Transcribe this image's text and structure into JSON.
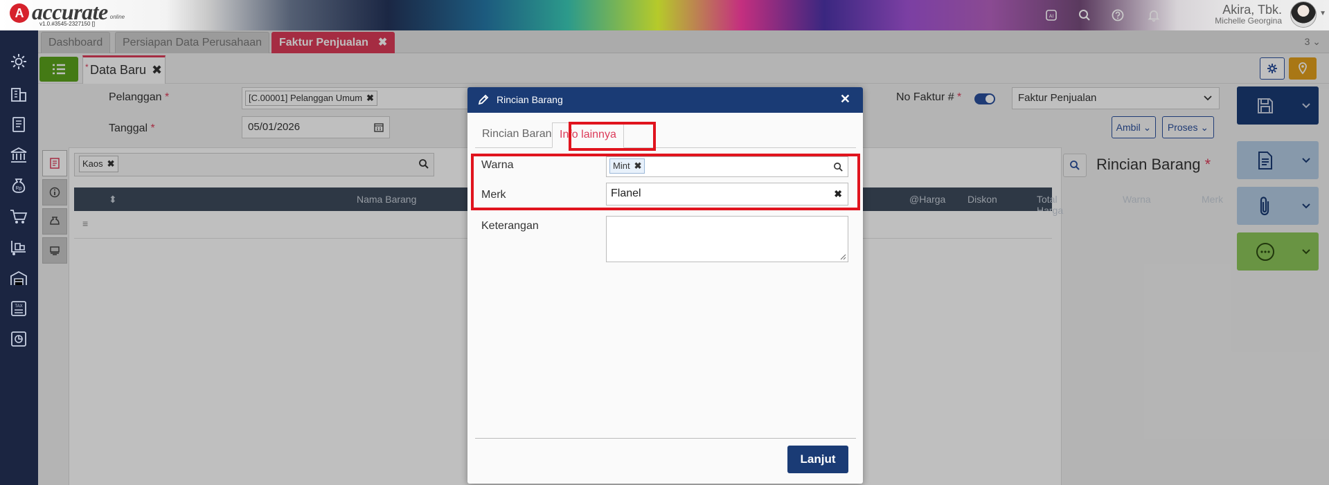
{
  "app": {
    "logo_letter": "A",
    "logo_name": "accurate",
    "logo_suffix": "online",
    "version": "v1.0.#3545-2327150 []",
    "company": "Akira, Tbk.",
    "user": "Michelle Georgina"
  },
  "tabs": {
    "items": [
      {
        "label": "Dashboard"
      },
      {
        "label": "Persiapan Data Perusahaan"
      },
      {
        "label": "Faktur Penjualan",
        "close": "✖"
      }
    ],
    "count": "3 ⌄"
  },
  "document_tab": {
    "star": "*",
    "label": "Data Baru",
    "close": "✖"
  },
  "form": {
    "pelanggan_label": "Pelanggan",
    "required_mark": "*",
    "pelanggan_value": "[C.00001] Pelanggan Umum",
    "pelanggan_remove": "✖",
    "tanggal_label": "Tanggal",
    "tanggal_value": "05/01/2026",
    "no_faktur_label": "No Faktur #",
    "faktur_type": "Faktur Penjualan",
    "ambil_label": "Ambil",
    "proses_label": "Proses"
  },
  "grid": {
    "filter_chip": "Kaos",
    "filter_remove": "✖",
    "sort_icon": "⬍",
    "panel_title": "Rincian Barang",
    "columns": {
      "nama_barang": "Nama Barang",
      "harga": "@Harga",
      "diskon": "Diskon",
      "total_harga": "Total Harga",
      "warna": "Warna",
      "merk": "Merk"
    },
    "row_handle": "≡"
  },
  "dialog": {
    "title": "Rincian Barang",
    "close": "✕",
    "tabs": {
      "rincian": "Rincian Barang",
      "info": "Info lainnya"
    },
    "warna_label": "Warna",
    "warna_chip": "Mint",
    "warna_remove": "✖",
    "merk_label": "Merk",
    "merk_value": "Flanel",
    "merk_clear": "✖",
    "keterangan_label": "Keterangan",
    "keterangan_value": "",
    "lanjut_label": "Lanjut"
  },
  "colors": {
    "sidebar": "#1b2541",
    "active_tab": "#dc3b59",
    "dialog_header": "#1a3b75",
    "highlight": "#e0141e",
    "save_button": "#1a3b75",
    "print_button": "#b5cde4",
    "more_button": "#8cc65a"
  },
  "icons": [
    "settings-icon",
    "building-icon",
    "book-icon",
    "bank-icon",
    "money-bag-icon",
    "cart-icon",
    "trolley-icon",
    "warehouse-icon",
    "tax-icon",
    "report-icon",
    "ai-icon",
    "search-icon",
    "help-icon",
    "bell-icon",
    "pencil-icon",
    "save-icon",
    "document-icon",
    "paperclip-icon",
    "more-icon",
    "gear-icon",
    "pin-icon",
    "list-icon",
    "calendar-icon"
  ]
}
